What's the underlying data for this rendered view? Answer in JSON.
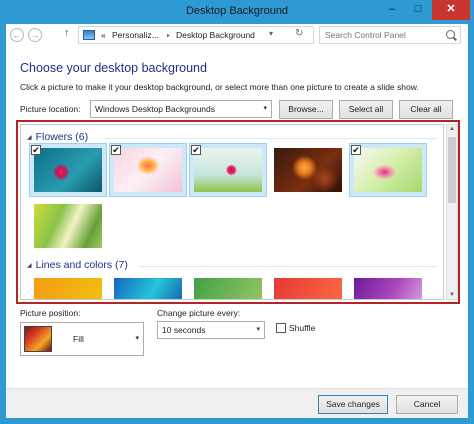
{
  "window": {
    "title": "Desktop Background",
    "minimize_glyph": "–",
    "maximize_glyph": "□",
    "close_glyph": "✕"
  },
  "nav": {
    "back_glyph": "←",
    "forward_glyph": "→",
    "up_glyph": "↑",
    "chevron": "«",
    "crumbs": [
      "Personaliz...",
      "Desktop Background"
    ],
    "separator": "▸",
    "dropdown_glyph": "▾",
    "refresh_glyph": "↻",
    "search_placeholder": "Search Control Panel"
  },
  "main": {
    "heading": "Choose your desktop background",
    "instruction": "Click a picture to make it your desktop background, or select more than one picture to create a slide show.",
    "location_label": "Picture location:",
    "location_value": "Windows Desktop Backgrounds",
    "browse_label": "Browse...",
    "select_all_label": "Select all",
    "clear_all_label": "Clear all"
  },
  "gallery": {
    "groups": [
      {
        "label": "Flowers (6)",
        "items": [
          {
            "checked": true,
            "colors": [
              "#0d6f8a",
              "#2a9cb0",
              "#c2185b",
              "#e91e63"
            ]
          },
          {
            "checked": true,
            "colors": [
              "#f6d5e3",
              "#fdeff5",
              "#ff7043",
              "#ffb74d"
            ]
          },
          {
            "checked": true,
            "colors": [
              "#c8e6dc",
              "#e8f4f0",
              "#c2185b",
              "#8bc34a"
            ]
          },
          {
            "checked": false,
            "colors": [
              "#3a1a0c",
              "#7a2e10",
              "#e8781f",
              "#f5b041"
            ]
          },
          {
            "checked": true,
            "colors": [
              "#d8f0b0",
              "#a5d86f",
              "#e0307a",
              "#f8f8f8"
            ]
          },
          {
            "checked": false,
            "colors": [
              "#8bc34a",
              "#cddc39",
              "#f0f4c3",
              "#689f38"
            ]
          }
        ]
      },
      {
        "label": "Lines and colors (7)",
        "items": [
          {
            "checked": false,
            "colors": [
              "#f39c12",
              "#f1c40f"
            ]
          },
          {
            "checked": false,
            "colors": [
              "#1565c0",
              "#26c6da"
            ]
          },
          {
            "checked": false,
            "colors": [
              "#43a047",
              "#9ccc65"
            ]
          },
          {
            "checked": false,
            "colors": [
              "#5c6bc0",
              "#29b6f6"
            ]
          },
          {
            "checked": false,
            "colors": [
              "#e53935",
              "#ff7043"
            ]
          },
          {
            "checked": false,
            "colors": [
              "#6a1b9a",
              "#ab47bc"
            ]
          }
        ]
      }
    ],
    "check_glyph": "✔",
    "group_triangle": "◢",
    "scroll_up_glyph": "▲",
    "scroll_down_glyph": "▼"
  },
  "options": {
    "position_label": "Picture position:",
    "position_value": "Fill",
    "change_label": "Change picture every:",
    "change_value": "10 seconds",
    "shuffle_label": "Shuffle",
    "shuffle_checked": false
  },
  "footer": {
    "save_label": "Save changes",
    "cancel_label": "Cancel"
  }
}
